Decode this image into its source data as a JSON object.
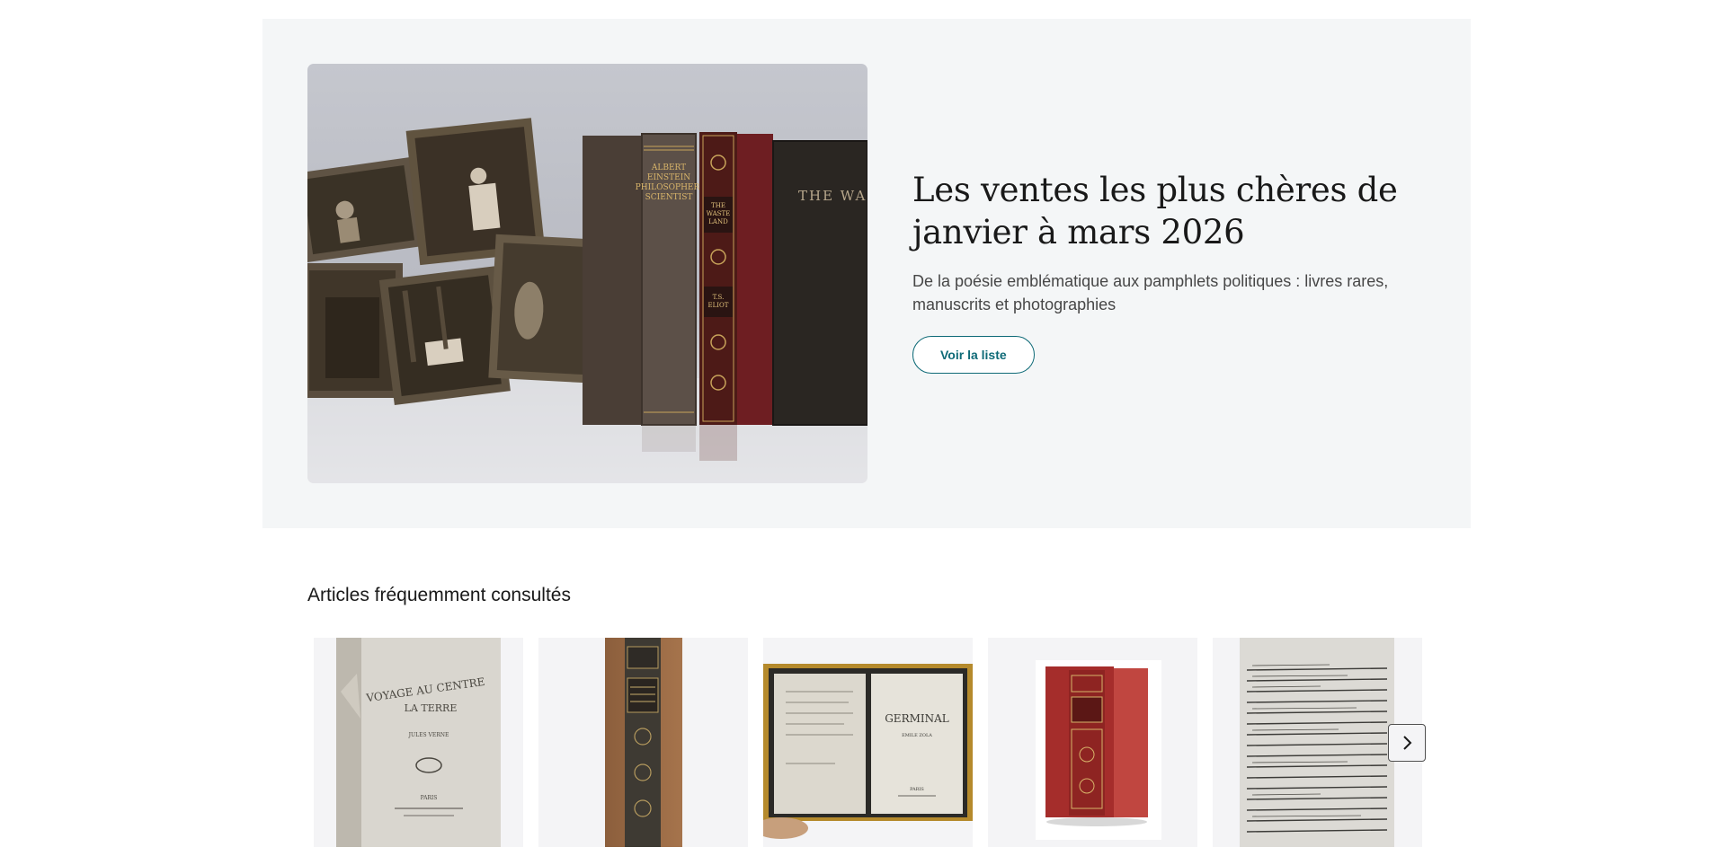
{
  "hero": {
    "title": "Les ventes les plus chères de janvier à mars 2026",
    "subtitle": "De la poésie emblématique aux pamphlets politiques : livres rares, manuscrits et photographies",
    "button_label": "Voir la liste",
    "image_spine_texts": {
      "einstein": [
        "ALBERT",
        "EINSTEIN",
        "PHILOSOPHER-",
        "SCIENTIST"
      ],
      "waste_land": [
        "THE",
        "WASTE",
        "LAND"
      ],
      "eliot": [
        "T.S.",
        "ELIOT"
      ],
      "cover": "THE WAST"
    }
  },
  "frequently_viewed": {
    "title": "Articles fréquemment consultés",
    "items": [
      {
        "name": "voyage-au-centre-de-la-terre",
        "cover_lines": [
          "VOYAGE AU CENTRE",
          "LA TERRE",
          "JULES VERNE",
          "PARIS"
        ]
      },
      {
        "name": "decorated-spine-volume"
      },
      {
        "name": "germinal",
        "cover_lines": [
          "GERMINAL",
          "EMILE ZOLA",
          "PARIS"
        ]
      },
      {
        "name": "red-leather-volume"
      },
      {
        "name": "manuscript-page"
      }
    ],
    "next_icon": "chevron-right-icon"
  },
  "colors": {
    "accent": "#0e6a77",
    "hero_background": "#f4f6f7",
    "card_background": "#f4f4f6",
    "title_text": "#191919"
  }
}
